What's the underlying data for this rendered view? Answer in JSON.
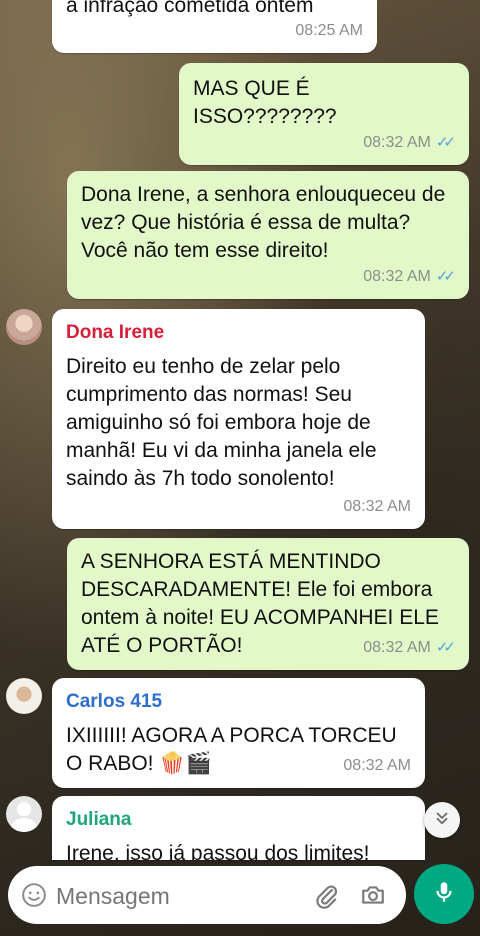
{
  "messages": [
    {
      "type": "in",
      "text": "a infração cometida ontem",
      "time": "08:25 AM"
    },
    {
      "type": "out",
      "text": "MAS QUE É ISSO????????",
      "time": "08:32 AM"
    },
    {
      "type": "out",
      "text": "Dona Irene, a senhora enlouqueceu de vez? Que história é essa de multa? Você não tem esse direito!",
      "time": "08:32 AM"
    },
    {
      "type": "in",
      "sender": "Dona Irene",
      "sender_color": "#d6203a",
      "text": "Direito eu tenho de zelar pelo cumprimento das normas! Seu amiguinho só foi embora hoje de manhã! Eu vi da minha janela ele saindo às 7h todo sonolento!",
      "time": "08:32 AM"
    },
    {
      "type": "out",
      "text": "A SENHORA ESTÁ MENTINDO DESCARADAMENTE! Ele foi embora ontem à noite! EU ACOMPANHEI ELE ATÉ O PORTÃO!",
      "time": "08:32 AM"
    },
    {
      "type": "in",
      "sender": "Carlos 415",
      "sender_color": "#2d6fcf",
      "text": "IXIIIIII! AGORA A PORCA TORCEU O RABO! 🍿🎬",
      "time": "08:32 AM"
    },
    {
      "type": "in",
      "sender": "Juliana",
      "sender_color": "#1fa67a",
      "text": "Irene, isso já passou dos limites!",
      "time": ""
    }
  ],
  "composer": {
    "placeholder": "Mensagem",
    "icons": [
      "emoji-icon",
      "attach-icon",
      "camera-icon",
      "mic-icon"
    ]
  },
  "colors": {
    "outgoing_bubble": "#e2f8c8",
    "incoming_bubble": "#ffffff",
    "read_ticks": "#4fa6e0",
    "mic_button": "#00a884"
  }
}
